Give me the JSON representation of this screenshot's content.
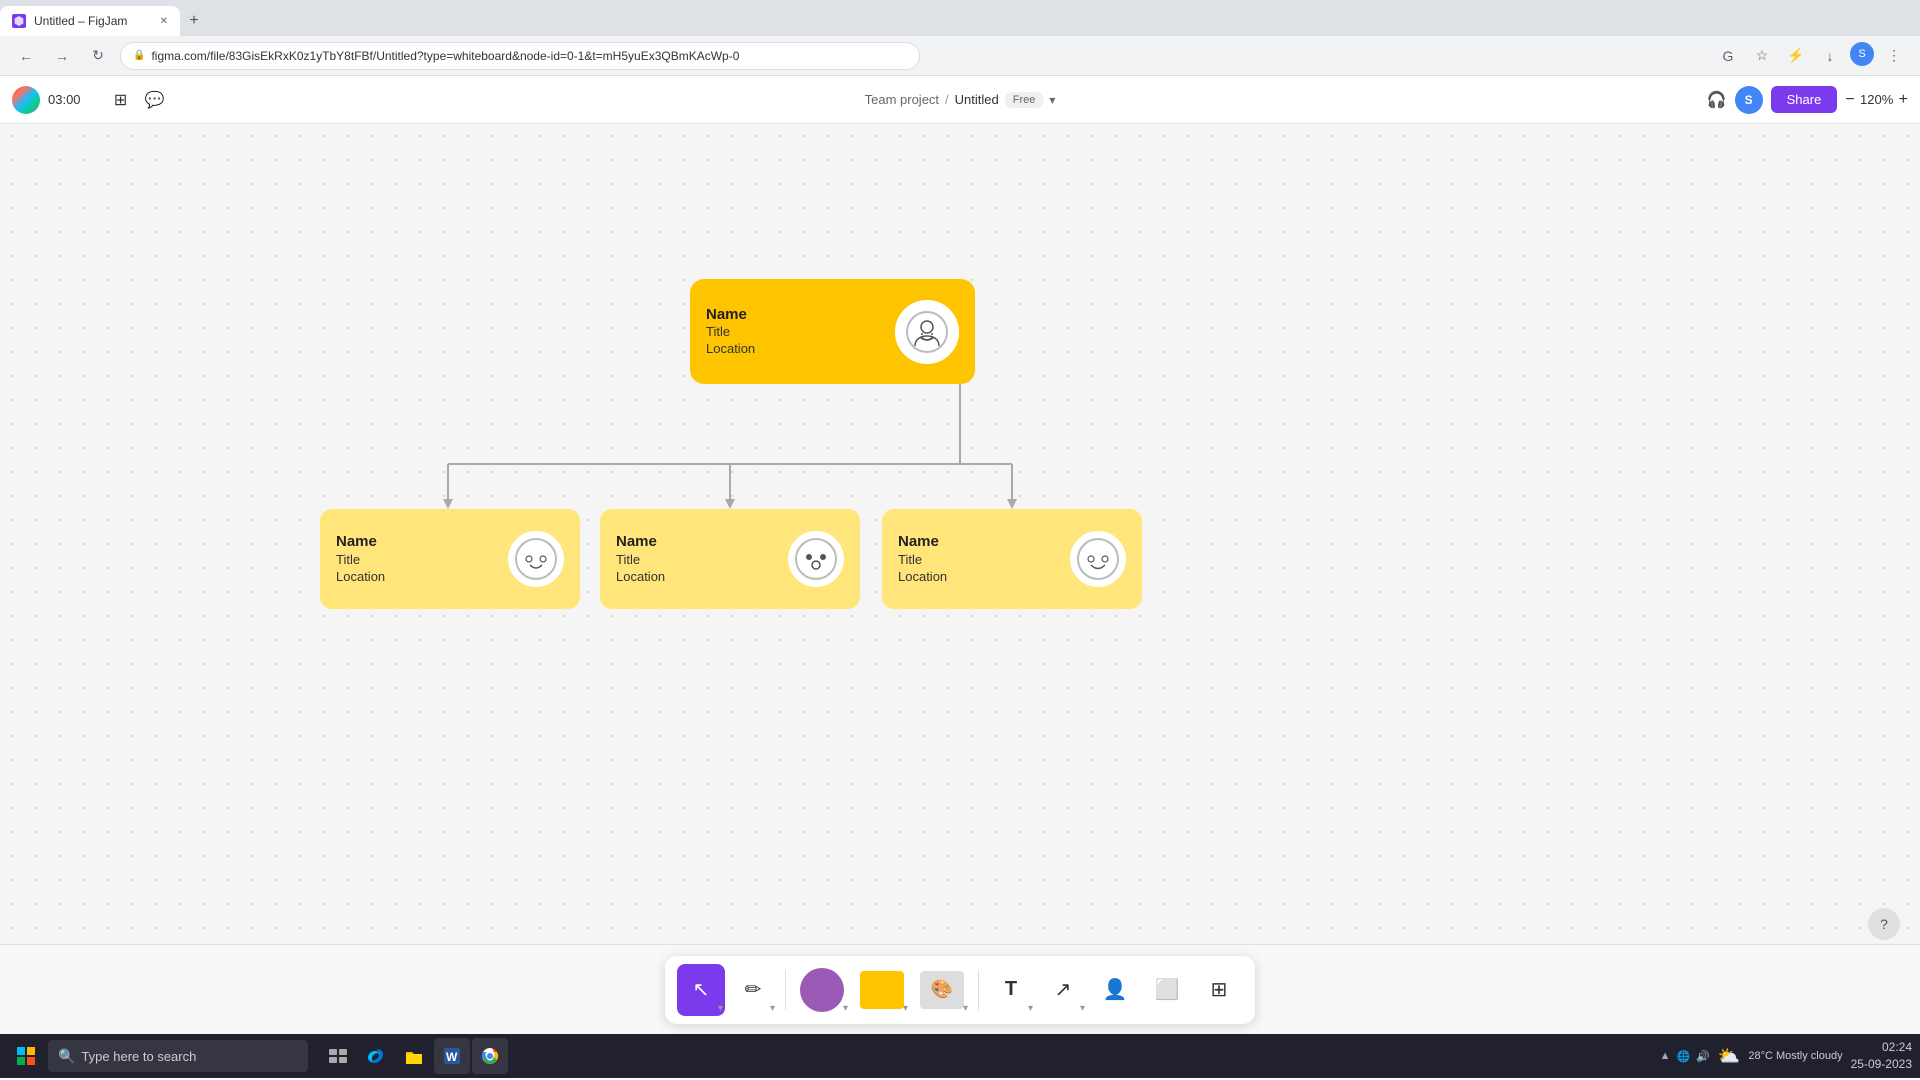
{
  "browser": {
    "tab_title": "Untitled – FigJam",
    "url": "figma.com/file/83GisEkRxK0z1yTbY8tFBf/Untitled?type=whiteboard&node-id=0-1&t=mH5yuEx3QBmKAcWp-0",
    "nav_back": "←",
    "nav_forward": "→",
    "nav_refresh": "↻"
  },
  "app": {
    "title": "Untitled",
    "breadcrumb_project": "Team project",
    "breadcrumb_sep": "/",
    "breadcrumb_file": "Untitled",
    "free_label": "Free",
    "share_label": "Share",
    "zoom": "120%",
    "timer": "03:00"
  },
  "orgchart": {
    "root": {
      "name": "Name",
      "title": "Title",
      "location": "Location"
    },
    "children": [
      {
        "name": "Name",
        "title": "Title",
        "location": "Location"
      },
      {
        "name": "Name",
        "title": "Title",
        "location": "Location"
      },
      {
        "name": "Name",
        "title": "Title",
        "location": "Location"
      }
    ]
  },
  "toolbar": {
    "cursor_label": "Cursor",
    "pen_label": "Pen",
    "shapes_label": "Shapes",
    "stickers_label": "Stickers",
    "text_label": "Text",
    "connect_label": "Connect",
    "person_label": "Person",
    "frame_label": "Frame",
    "table_label": "Table"
  },
  "taskbar": {
    "search_placeholder": "Type here to search",
    "weather": "28°C Mostly cloudy",
    "time": "02:24",
    "date": "25-09-2023"
  }
}
